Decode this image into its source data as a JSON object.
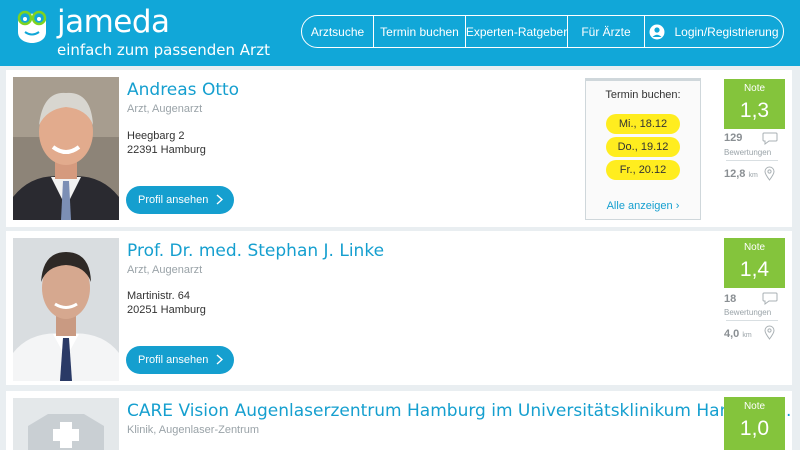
{
  "brand": {
    "title": "jameda",
    "tagline": "einfach zum passenden Arzt",
    "logo_icon": "doctor-face-icon",
    "color": "#11a7d8"
  },
  "nav": {
    "items": [
      "Arztsuche",
      "Termin buchen",
      "Experten-Ratgeber",
      "Für Ärzte"
    ],
    "login": "Login/Registrierung",
    "login_icon": "user-icon"
  },
  "results": [
    {
      "name": "Andreas Otto",
      "specialty": "Arzt, Augenarzt",
      "street": "Heegbarg 2",
      "city": "22391 Hamburg",
      "profile_button": "Profil ansehen",
      "booking": {
        "title": "Termin buchen:",
        "slots": [
          "Mi., 18.12",
          "Do., 19.12",
          "Fr., 20.12"
        ],
        "all_link": "Alle anzeigen"
      },
      "grade_label": "Note",
      "grade": "1,3",
      "reviews": "129",
      "reviews_label": "Bewertungen",
      "distance": "12,8",
      "distance_unit": "km"
    },
    {
      "name": "Prof. Dr. med. Stephan J. Linke",
      "specialty": "Arzt, Augenarzt",
      "street": "Martinistr. 64",
      "city": "20251 Hamburg",
      "profile_button": "Profil ansehen",
      "grade_label": "Note",
      "grade": "1,4",
      "reviews": "18",
      "reviews_label": "Bewertungen",
      "distance": "4,0",
      "distance_unit": "km"
    },
    {
      "name": "CARE Vision Augenlaserzentrum Hamburg im Universitätsklinikum Hamburg...",
      "specialty": "Klinik, Augenlaser-Zentrum",
      "grade_label": "Note",
      "grade": "1,0",
      "placeholder_icon": "clinic-placeholder-icon"
    }
  ],
  "colors": {
    "accent": "#159fcf",
    "grade_green": "#84c43c",
    "slot_yellow": "#ffed1f"
  }
}
